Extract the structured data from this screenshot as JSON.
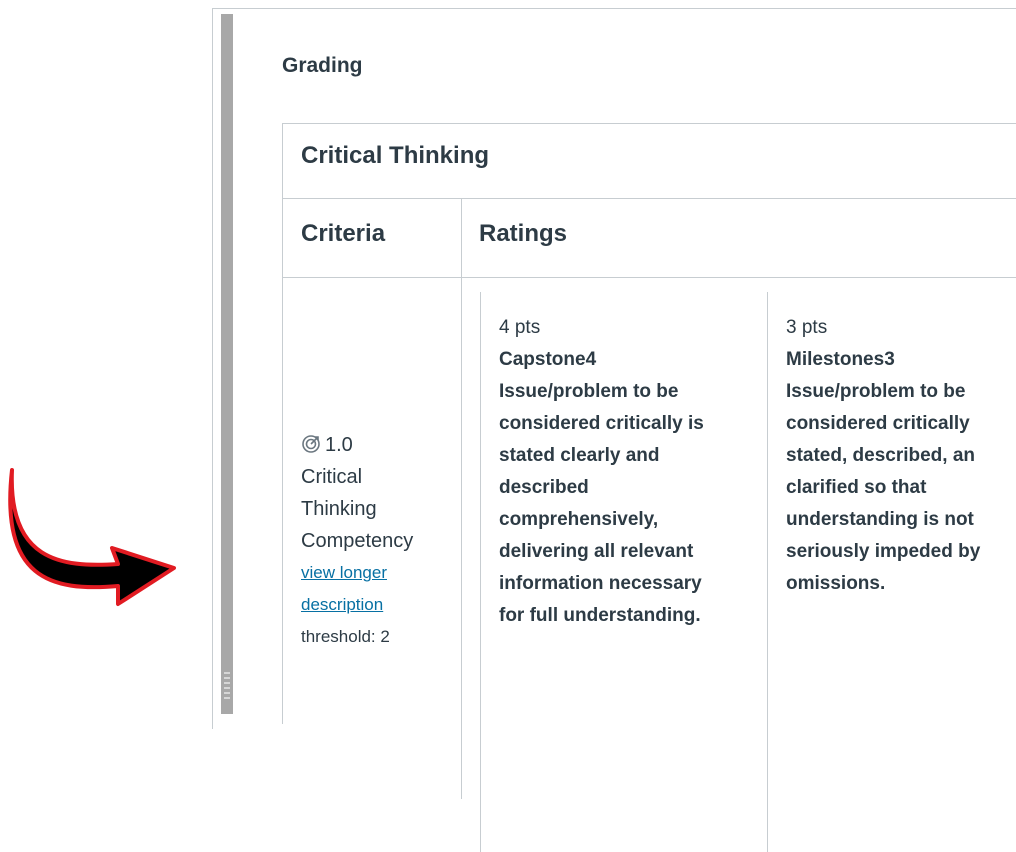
{
  "annotation": {
    "icon": "curved-arrow-icon",
    "color_fill": "#000000",
    "color_outline": "#e11b22"
  },
  "section_title": "Grading",
  "rubric": {
    "title": "Critical Thinking",
    "headers": {
      "criteria": "Criteria",
      "ratings": "Ratings"
    },
    "criterion": {
      "icon": "outcome-target-icon",
      "score": "1.0",
      "name_lines": [
        "Critical",
        "Thinking",
        "Competency"
      ],
      "link_lines": [
        "view longer",
        "description"
      ],
      "threshold": "threshold: 2"
    },
    "ratings": [
      {
        "points": "4 pts",
        "name": "Capstone4",
        "description": "Issue/problem to be\nconsidered critically is\nstated clearly and\ndescribed\ncomprehensively,\ndelivering all relevant\ninformation necessary\nfor full understanding."
      },
      {
        "points": "3 pts",
        "name": "Milestones3",
        "description": "Issue/problem to be\nconsidered critically\nstated, described, an\nclarified so that\nunderstanding is not\nseriously impeded by\nomissions."
      }
    ]
  }
}
